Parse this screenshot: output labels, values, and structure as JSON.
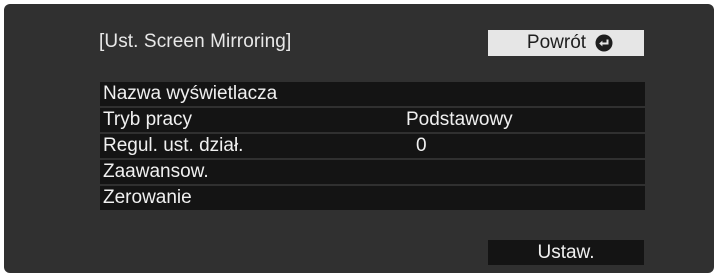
{
  "screen": {
    "title": "[Ust. Screen Mirroring]"
  },
  "back_button": {
    "label": "Powrót",
    "icon": "return-arrow-icon"
  },
  "menu": {
    "items": [
      {
        "label": "Nazwa wyświetlacza",
        "value": ""
      },
      {
        "label": "Tryb pracy",
        "value": "Podstawowy"
      },
      {
        "label": "Regul. ust. dział.",
        "value": "0"
      },
      {
        "label": "Zaawansow.",
        "value": ""
      },
      {
        "label": "Zerowanie",
        "value": ""
      }
    ]
  },
  "set_button": {
    "label": "Ustaw."
  },
  "colors": {
    "panel_background": "#303030",
    "item_background": "#141414",
    "button_light": "#e6e6e6",
    "text_light": "#f0f0f0",
    "text_dark": "#1e1e1e"
  }
}
